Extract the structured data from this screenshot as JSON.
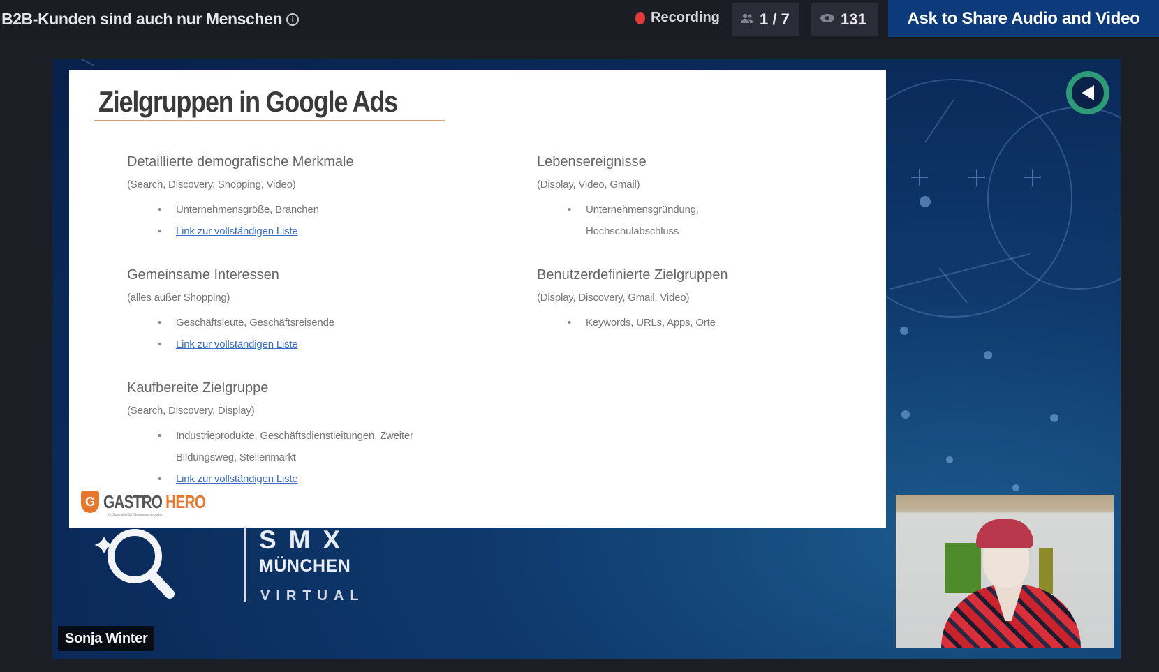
{
  "header": {
    "title": "B2B-Kunden sind auch nur Menschen",
    "info_icon": "info-circle-icon",
    "recording_label": "Recording",
    "participants": "1 / 7",
    "participants_icon": "people-icon",
    "viewers": "131",
    "viewers_icon": "eye-icon",
    "share_button": "Ask to Share Audio and Video"
  },
  "slide": {
    "title": "Zielgruppen in Google Ads",
    "left_column": [
      {
        "heading": "Detaillierte demografische Merkmale",
        "channels": "(Search, Discovery, Shopping, Video)",
        "bullets": [
          {
            "text": "Unternehmensgröße, Branchen",
            "link": false
          },
          {
            "text": "Link zur vollständigen Liste",
            "link": true
          }
        ]
      },
      {
        "heading": "Gemeinsame Interessen",
        "channels": "(alles außer Shopping)",
        "bullets": [
          {
            "text": "Geschäftsleute, Geschäftsreisende",
            "link": false
          },
          {
            "text": "Link zur vollständigen Liste",
            "link": true
          }
        ]
      },
      {
        "heading": "Kaufbereite Zielgruppe",
        "channels": "(Search, Discovery, Display)",
        "bullets": [
          {
            "text": "Industrieprodukte, Geschäftsdienstleitungen, Zweiter Bildungsweg, Stellenmarkt",
            "link": false
          },
          {
            "text": "Link zur vollständigen Liste",
            "link": true
          }
        ]
      }
    ],
    "right_column": [
      {
        "heading": "Lebensereignisse",
        "channels": "(Display, Video, Gmail)",
        "bullets": [
          {
            "text": "Unternehmensgründung, Hochschulabschluss",
            "link": false
          }
        ]
      },
      {
        "heading": "Benutzerdefinierte Zielgruppen",
        "channels": "(Display, Discovery, Gmail, Video)",
        "bullets": [
          {
            "text": "Keywords, URLs, Apps, Orte",
            "link": false
          }
        ]
      }
    ],
    "brand": {
      "part1": "GASTRO",
      "part2": "HERO",
      "letter": "G",
      "tagline": "Ihr Spezialist für Gastronomiebedarf"
    }
  },
  "event_logo": {
    "line1": "SMX",
    "line2": "MÜNCHEN",
    "line3": "VIRTUAL"
  },
  "speaker": {
    "name": "Sonja Winter"
  },
  "controls": {
    "sound_icon": "speaker-icon"
  },
  "colors": {
    "accent_blue": "#0d3a7a",
    "recording_red": "#e23a3a",
    "sound_ring": "#2f9a77",
    "brand_orange": "#e8772e",
    "link_blue": "#3a6cc6"
  }
}
